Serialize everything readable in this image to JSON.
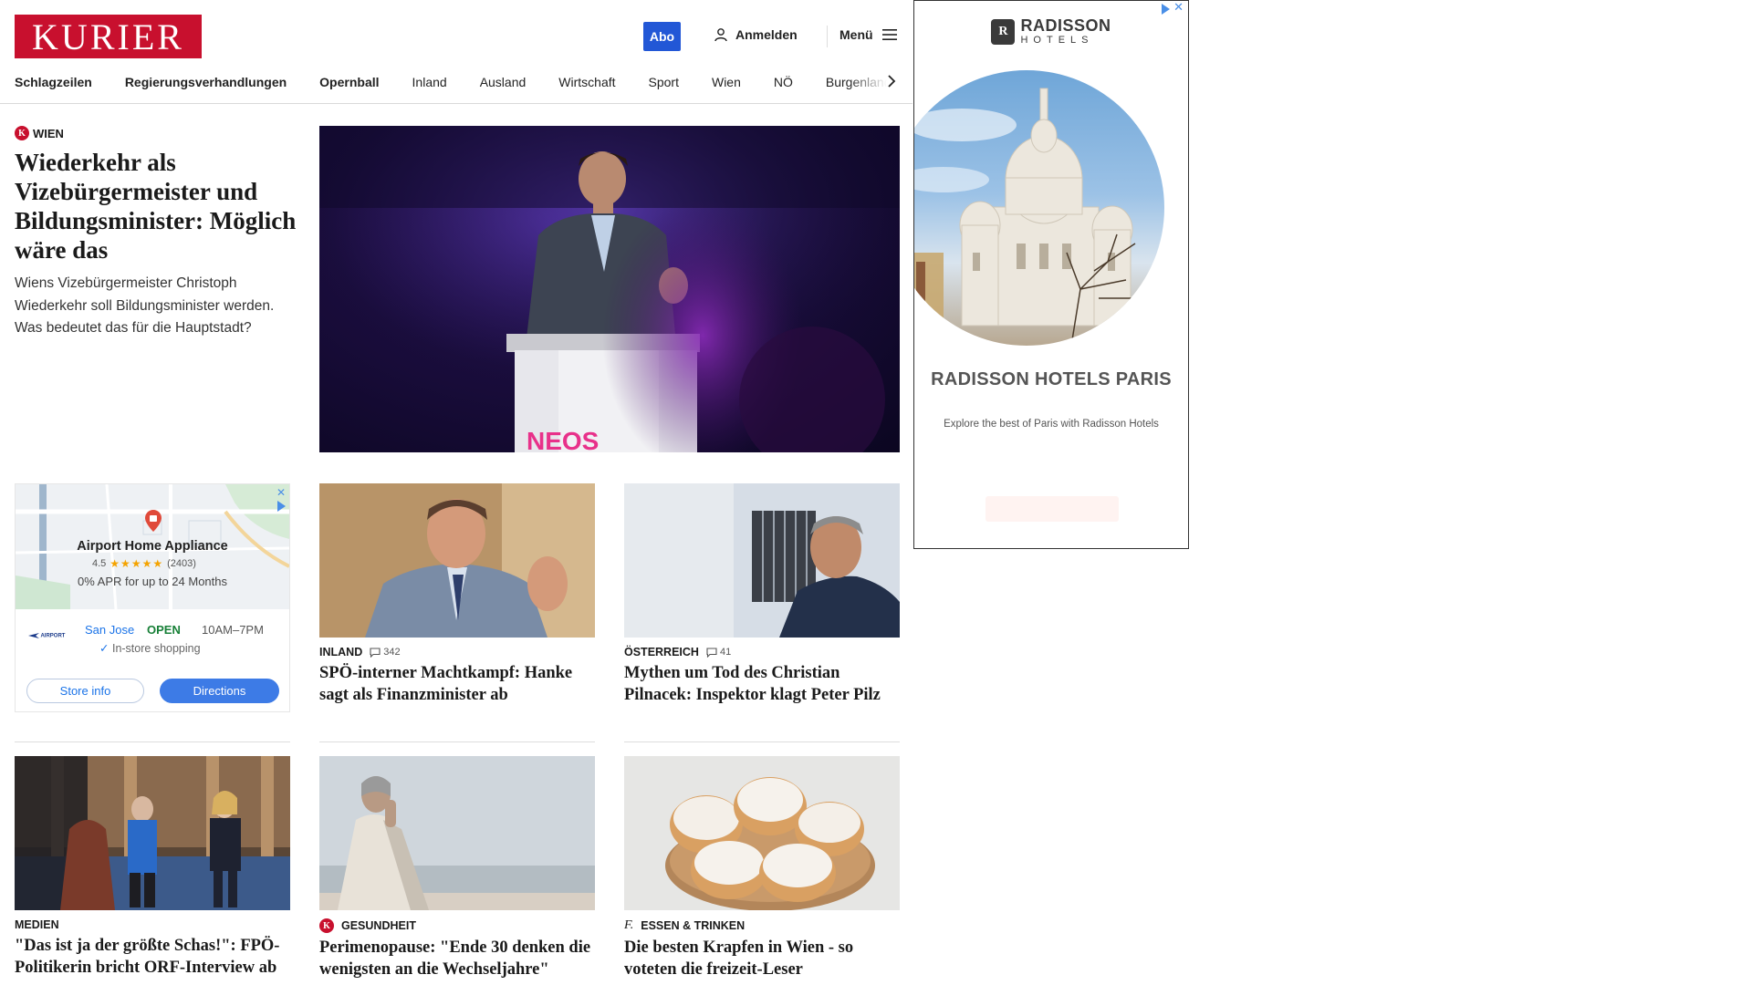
{
  "header": {
    "logo_text": "KURIER",
    "abo_label": "Abo",
    "login_label": "Anmelden",
    "menu_label": "Menü",
    "brand_color": "#c8102e",
    "accent_color": "#2257d6"
  },
  "nav": {
    "items": [
      "Schlagzeilen",
      "Regierungsverhandlungen",
      "Opernball",
      "Inland",
      "Ausland",
      "Wirtschaft",
      "Sport",
      "Wien",
      "NÖ",
      "Burgenland"
    ]
  },
  "hero": {
    "kicker": "WIEN",
    "title": "Wiederkehr als Vizebürgermeister und Bildungsminister: Möglich wäre das",
    "lead": "Wiens Vizebürgermeister Christoph Wiederkehr soll Bildungsminister werden. Was bedeutet das für die Hauptstadt?",
    "image_caption_text": "NEOS"
  },
  "map_ad": {
    "store_name": "Airport Home Appliance",
    "rating": "4.5",
    "review_count": "(2403)",
    "offer": "0% APR for up to 24 Months",
    "brand_logo_text": "AIRPORT",
    "city": "San Jose",
    "status": "OPEN",
    "hours": "10AM–7PM",
    "feature": "In-store shopping",
    "store_info_label": "Store info",
    "directions_label": "Directions"
  },
  "cards": [
    {
      "category": "INLAND",
      "comments": "342",
      "title": "SPÖ-interner Machtkampf: Hanke sagt als Finanzminister ab"
    },
    {
      "category": "ÖSTERREICH",
      "comments": "41",
      "title": "Mythen um Tod des Christian Pilnacek: Inspektor klagt Peter Pilz"
    },
    {
      "category": "MEDIEN",
      "comments": "",
      "title": "\"Das ist ja der größte Schas!\": FPÖ-Politikerin bricht ORF-Interview ab"
    },
    {
      "category": "GESUNDHEIT",
      "comments": "",
      "title": "Perimenopause: \"Ende 30 denken die wenigsten an die Wechseljahre\""
    },
    {
      "category": "ESSEN & TRINKEN",
      "comments": "",
      "title": "Die besten Krapfen in Wien - so voteten die freizeit-Leser"
    }
  ],
  "right_ad": {
    "brand_name": "RADISSON",
    "brand_sub": "HOTELS",
    "headline": "RADISSON HOTELS PARIS",
    "description": "Explore the best of Paris with Radisson Hotels"
  }
}
